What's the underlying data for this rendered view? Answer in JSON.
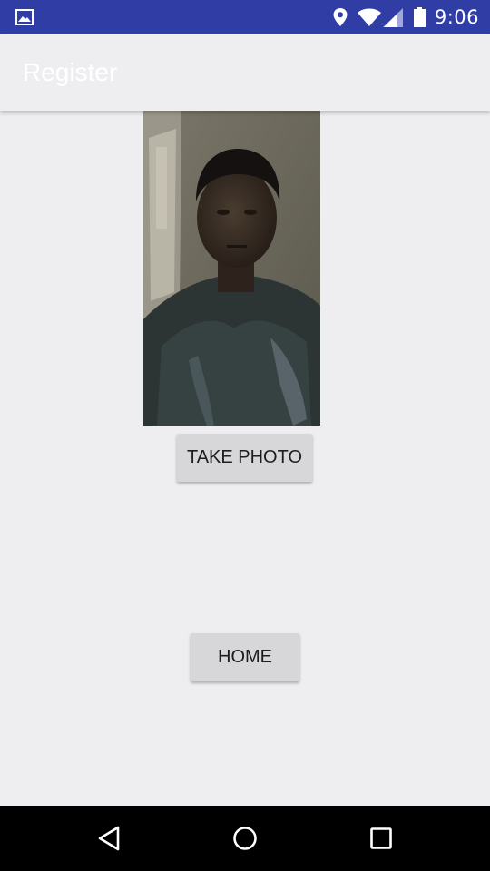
{
  "status_bar": {
    "time": "9:06",
    "notification_icon": "gallery-icon",
    "icons": [
      "location-icon",
      "wifi-icon",
      "cell-signal-icon",
      "battery-icon"
    ],
    "background_color": "#2f3da4"
  },
  "app_bar": {
    "title": "Register"
  },
  "photo_preview": {
    "description_icon": "captured-photo"
  },
  "buttons": {
    "take_photo": "TAKE PHOTO",
    "home": "HOME"
  },
  "nav_bar": {
    "back_icon": "back-triangle-icon",
    "home_icon": "home-circle-icon",
    "recents_icon": "recents-square-icon"
  },
  "colors": {
    "background": "#eeedf0",
    "button": "#d7d6d9",
    "nav": "#000000"
  }
}
